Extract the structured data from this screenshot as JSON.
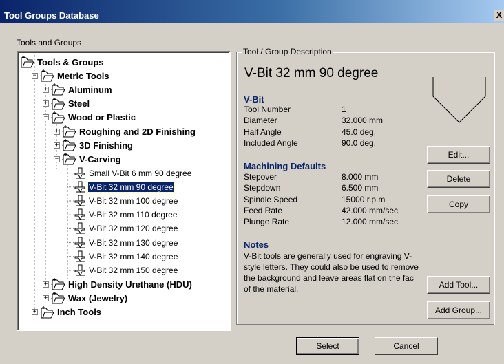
{
  "window": {
    "title": "Tool Groups Database",
    "close_label": "X"
  },
  "tools_label": "Tools and Groups",
  "tree": [
    {
      "label": "Tools & Groups",
      "expander": ""
    },
    {
      "label": "Metric Tools",
      "expander": "−"
    },
    {
      "label": "Aluminum",
      "expander": "+"
    },
    {
      "label": "Steel",
      "expander": "+"
    },
    {
      "label": "Wood or Plastic",
      "expander": "−"
    },
    {
      "label": "Roughing and 2D Finishing",
      "expander": "+"
    },
    {
      "label": "3D Finishing",
      "expander": "+"
    },
    {
      "label": "V-Carving",
      "expander": "−"
    },
    {
      "label": "Small V-Bit 6 mm 90 degree",
      "expander": ""
    },
    {
      "label": "V-Bit 32 mm 90 degree",
      "expander": "",
      "selected": true
    },
    {
      "label": "V-Bit 32 mm 100 degree",
      "expander": ""
    },
    {
      "label": "V-Bit 32 mm 110 degree",
      "expander": ""
    },
    {
      "label": "V-Bit 32 mm 120 degree",
      "expander": ""
    },
    {
      "label": "V-Bit 32 mm 130 degree",
      "expander": ""
    },
    {
      "label": "V-Bit 32 mm 140 degree",
      "expander": ""
    },
    {
      "label": "V-Bit 32 mm 150 degree",
      "expander": ""
    },
    {
      "label": "High Density Urethane (HDU)",
      "expander": "+"
    },
    {
      "label": "Wax (Jewelry)",
      "expander": "+"
    },
    {
      "label": "Inch Tools",
      "expander": "+"
    }
  ],
  "description": {
    "group_label": "Tool / Group Description",
    "title": "V-Bit 32 mm 90 degree",
    "vbit_heading": "V-Bit",
    "vbit_rows": [
      {
        "label": "Tool Number",
        "value": "1"
      },
      {
        "label": "Diameter",
        "value": "32.000 mm"
      },
      {
        "label": "Half Angle",
        "value": "45.0 deg."
      },
      {
        "label": "Included Angle",
        "value": "90.0 deg."
      }
    ],
    "machining_heading": "Machining Defaults",
    "machining_rows": [
      {
        "label": "Stepover",
        "value": "8.000 mm"
      },
      {
        "label": "Stepdown",
        "value": "6.500 mm"
      },
      {
        "label": "Spindle Speed",
        "value": "15000 r.p.m"
      },
      {
        "label": "Feed Rate",
        "value": "42.000 mm/sec"
      },
      {
        "label": "Plunge Rate",
        "value": "12.000 mm/sec"
      }
    ],
    "notes_heading": "Notes",
    "notes_text": "V-Bit tools are generally used for engraving V-style letters. They could also be used to remove the background and leave areas flat on the fac of the material."
  },
  "buttons": {
    "edit": "Edit...",
    "delete": "Delete",
    "copy": "Copy",
    "add_tool": "Add Tool...",
    "add_group": "Add Group...",
    "select": "Select",
    "cancel": "Cancel"
  },
  "colors": {
    "title_bar": "#0a246a",
    "selection": "#0a246a",
    "section_heading": "#0a246a",
    "dialog_bg": "#d4d0c8"
  }
}
